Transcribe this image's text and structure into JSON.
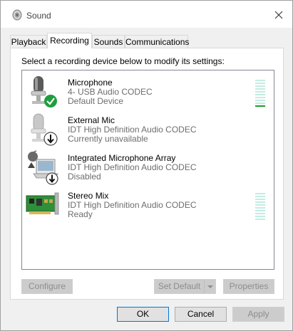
{
  "window": {
    "title": "Sound"
  },
  "tabs": [
    {
      "label": "Playback"
    },
    {
      "label": "Recording"
    },
    {
      "label": "Sounds"
    },
    {
      "label": "Communications"
    }
  ],
  "panel": {
    "instruction": "Select a recording device below to modify its settings:"
  },
  "devices": [
    {
      "name": "Microphone",
      "line2": "4- USB Audio CODEC",
      "line3": "Default Device",
      "icon": "microphone-default-icon",
      "meter": "visible",
      "level": 0.05
    },
    {
      "name": "External Mic",
      "line2": "IDT High Definition Audio CODEC",
      "line3": "Currently unavailable",
      "icon": "microphone-unavailable-icon"
    },
    {
      "name": "Integrated Microphone Array",
      "line2": "IDT High Definition Audio CODEC",
      "line3": "Disabled",
      "icon": "mic-array-disabled-icon"
    },
    {
      "name": "Stereo Mix",
      "line2": "IDT High Definition Audio CODEC",
      "line3": "Ready",
      "icon": "sound-card-icon",
      "meter": "visible",
      "level": 0
    }
  ],
  "buttons": {
    "configure": "Configure",
    "set_default": "Set Default",
    "properties": "Properties",
    "ok": "OK",
    "cancel": "Cancel",
    "apply": "Apply"
  },
  "colors": {
    "accent": "#0078d7",
    "meter_on": "#1d9b2e",
    "meter_off": "#c3ece3",
    "status_check": "#1e9e3e"
  }
}
